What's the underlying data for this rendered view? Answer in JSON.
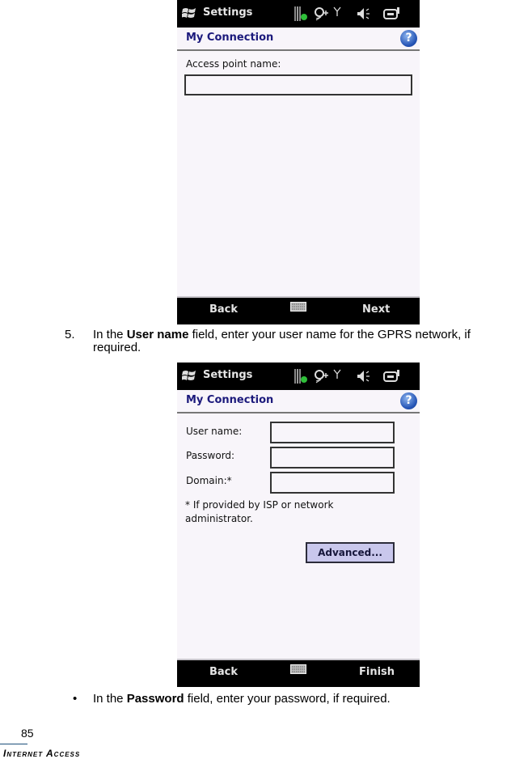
{
  "screens": [
    {
      "statusbar": {
        "title": "Settings",
        "icons": [
          "windows-logo-icon",
          "sim-status-icon",
          "location-sync-icon",
          "signal-antenna-icon",
          "speaker-icon",
          "battery-icon"
        ]
      },
      "header": {
        "title": "My Connection",
        "help": "?"
      },
      "fields": [
        {
          "label": "Access point name:",
          "value": "",
          "placeholder": ""
        }
      ],
      "softkeys": {
        "left": "Back",
        "right": "Next",
        "center_icon": "keyboard-icon"
      }
    },
    {
      "statusbar": {
        "title": "Settings",
        "icons": [
          "windows-logo-icon",
          "sim-status-icon",
          "location-sync-icon",
          "signal-antenna-icon",
          "speaker-icon",
          "battery-icon"
        ]
      },
      "header": {
        "title": "My Connection",
        "help": "?"
      },
      "fields": [
        {
          "label": "User name:",
          "value": "",
          "placeholder": ""
        },
        {
          "label": "Password:",
          "value": "",
          "placeholder": ""
        },
        {
          "label": "Domain:*",
          "value": "",
          "placeholder": ""
        }
      ],
      "footnote": {
        "line1": "* If provided by ISP or network",
        "line2": "administrator."
      },
      "advanced_button": "Advanced...",
      "softkeys": {
        "left": "Back",
        "right": "Finish",
        "center_icon": "keyboard-icon"
      }
    }
  ],
  "doc": {
    "step": {
      "number": "5.",
      "pre": "In the ",
      "bold": "User name",
      "post": " field, enter your user name for the GPRS network, if required."
    },
    "bullet": {
      "symbol": "•",
      "pre": "In the ",
      "bold": "Password",
      "post": " field, enter your password, if required."
    },
    "page_number": "85",
    "section": "Internet Access"
  }
}
